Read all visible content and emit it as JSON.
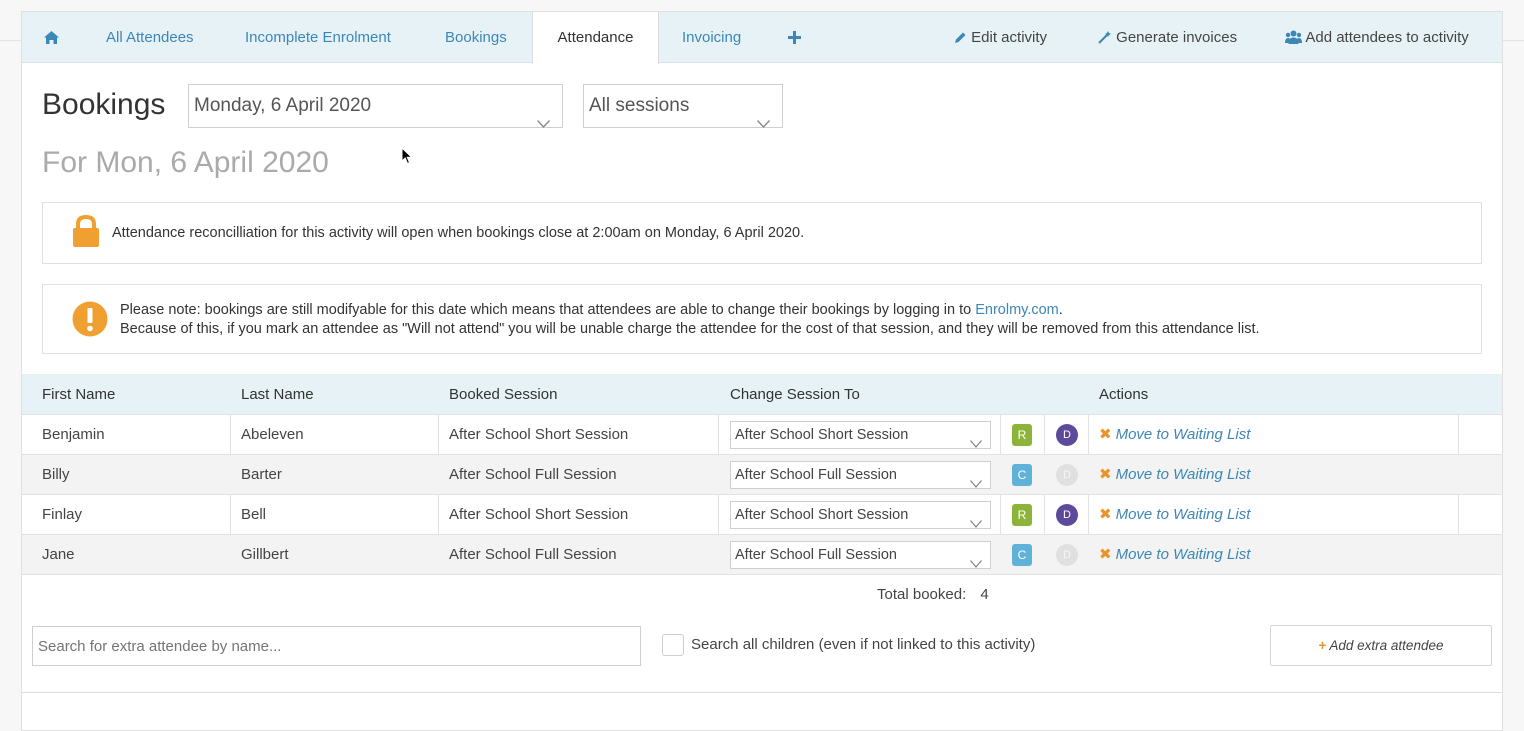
{
  "tabs": {
    "home_icon": "home-icon",
    "items": [
      "All Attendees",
      "Incomplete Enrolment",
      "Bookings",
      "Attendance",
      "Invoicing"
    ],
    "add_icon": "plus-icon",
    "edit_activity": "Edit activity",
    "generate_invoices": "Generate invoices",
    "add_attendees": "Add attendees to activity"
  },
  "header": {
    "title": "Bookings",
    "date_select": "Monday, 6 April 2020",
    "session_select": "All sessions",
    "subtitle": "For Mon, 6 April 2020"
  },
  "notices": {
    "lock_text": "Attendance reconcilliation for this activity will open when bookings close at 2:00am on Monday, 6 April 2020.",
    "warning_line1_prefix": "Please note: bookings are still modifyable for this date which means that attendees are able to change their bookings by logging in to ",
    "warning_link": "Enrolmy.com",
    "warning_line1_suffix": ".",
    "warning_line2": "Because of this, if you mark an attendee as \"Will not attend\" you will be unable charge the attendee for the cost of that session, and they will be removed from this attendance list."
  },
  "table": {
    "headers": [
      "First Name",
      "Last Name",
      "Booked Session",
      "Change Session To",
      "Actions"
    ],
    "rows": [
      {
        "first": "Benjamin",
        "last": "Abeleven",
        "booked": "After School Short Session",
        "change": "After School Short Session",
        "badge": "R",
        "circle": "D",
        "action": "Move to Waiting List"
      },
      {
        "first": "Billy",
        "last": "Barter",
        "booked": "After School Full Session",
        "change": "After School Full Session",
        "badge": "C",
        "circle": "D",
        "action": "Move to Waiting List"
      },
      {
        "first": "Finlay",
        "last": "Bell",
        "booked": "After School Short Session",
        "change": "After School Short Session",
        "badge": "R",
        "circle": "D",
        "action": "Move to Waiting List"
      },
      {
        "first": "Jane",
        "last": "Gillbert",
        "booked": "After School Full Session",
        "change": "After School Full Session",
        "badge": "C",
        "circle": "D",
        "action": "Move to Waiting List"
      }
    ]
  },
  "footer": {
    "total_label": "Total booked:",
    "total_value": "4",
    "search_placeholder": "Search for extra attendee by name...",
    "search_all_label": "Search all children (even if not linked to this activity)",
    "add_extra": "Add extra attendee"
  },
  "colors": {
    "link": "#3d87b8",
    "badge_r": "#8db43a",
    "badge_c": "#5fb3d9",
    "circle_active": "#5d4a9b",
    "circle_inactive": "#e0e0e0",
    "accent_orange": "#e8952c"
  }
}
